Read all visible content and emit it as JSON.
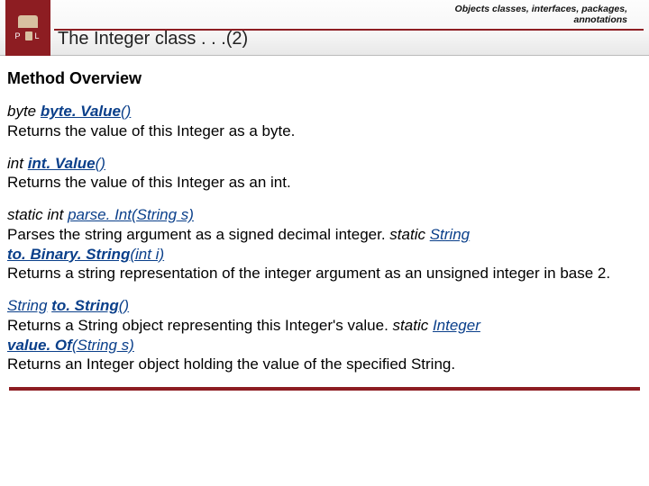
{
  "header": {
    "breadcrumb_line1": "Objects classes, interfaces, packages,",
    "breadcrumb_line2": "annotations",
    "title": "The Integer class . . .(2)",
    "logo_letters_left": "P",
    "logo_letters_right": "L"
  },
  "section_heading": "Method Overview",
  "m1": {
    "ret": "byte ",
    "name": "byte. Value",
    "paren": "()",
    "desc": "Returns the value of this Integer as a byte."
  },
  "m2": {
    "ret": "int ",
    "name": "int. Value",
    "paren": "()",
    "desc": "Returns the value of this Integer as an int."
  },
  "m3": {
    "ret": "static int ",
    "name": "parse. Int",
    "paren_open": "(",
    "param_type": "String",
    "param_rest": " s)",
    "desc1": "Parses the string argument as a signed decimal integer.  ",
    "inl_ret": "static ",
    "inl_type": "String",
    "name2": "to. Binary. String",
    "paren2": "(int i)",
    "desc2": "Returns a string representation of the integer argument as an unsigned integer in base 2."
  },
  "m4": {
    "ret_type": "String",
    "space": " ",
    "name": "to. String",
    "paren": "()",
    "desc1": "Returns a String object representing this Integer's value.  ",
    "inl_ret": "static ",
    "inl_type": "Integer",
    "name2": "value. Of",
    "paren2_open": "(",
    "param2_type": "String",
    "param2_rest": " s)",
    "desc2": "Returns an Integer object holding the value of the specified String."
  }
}
